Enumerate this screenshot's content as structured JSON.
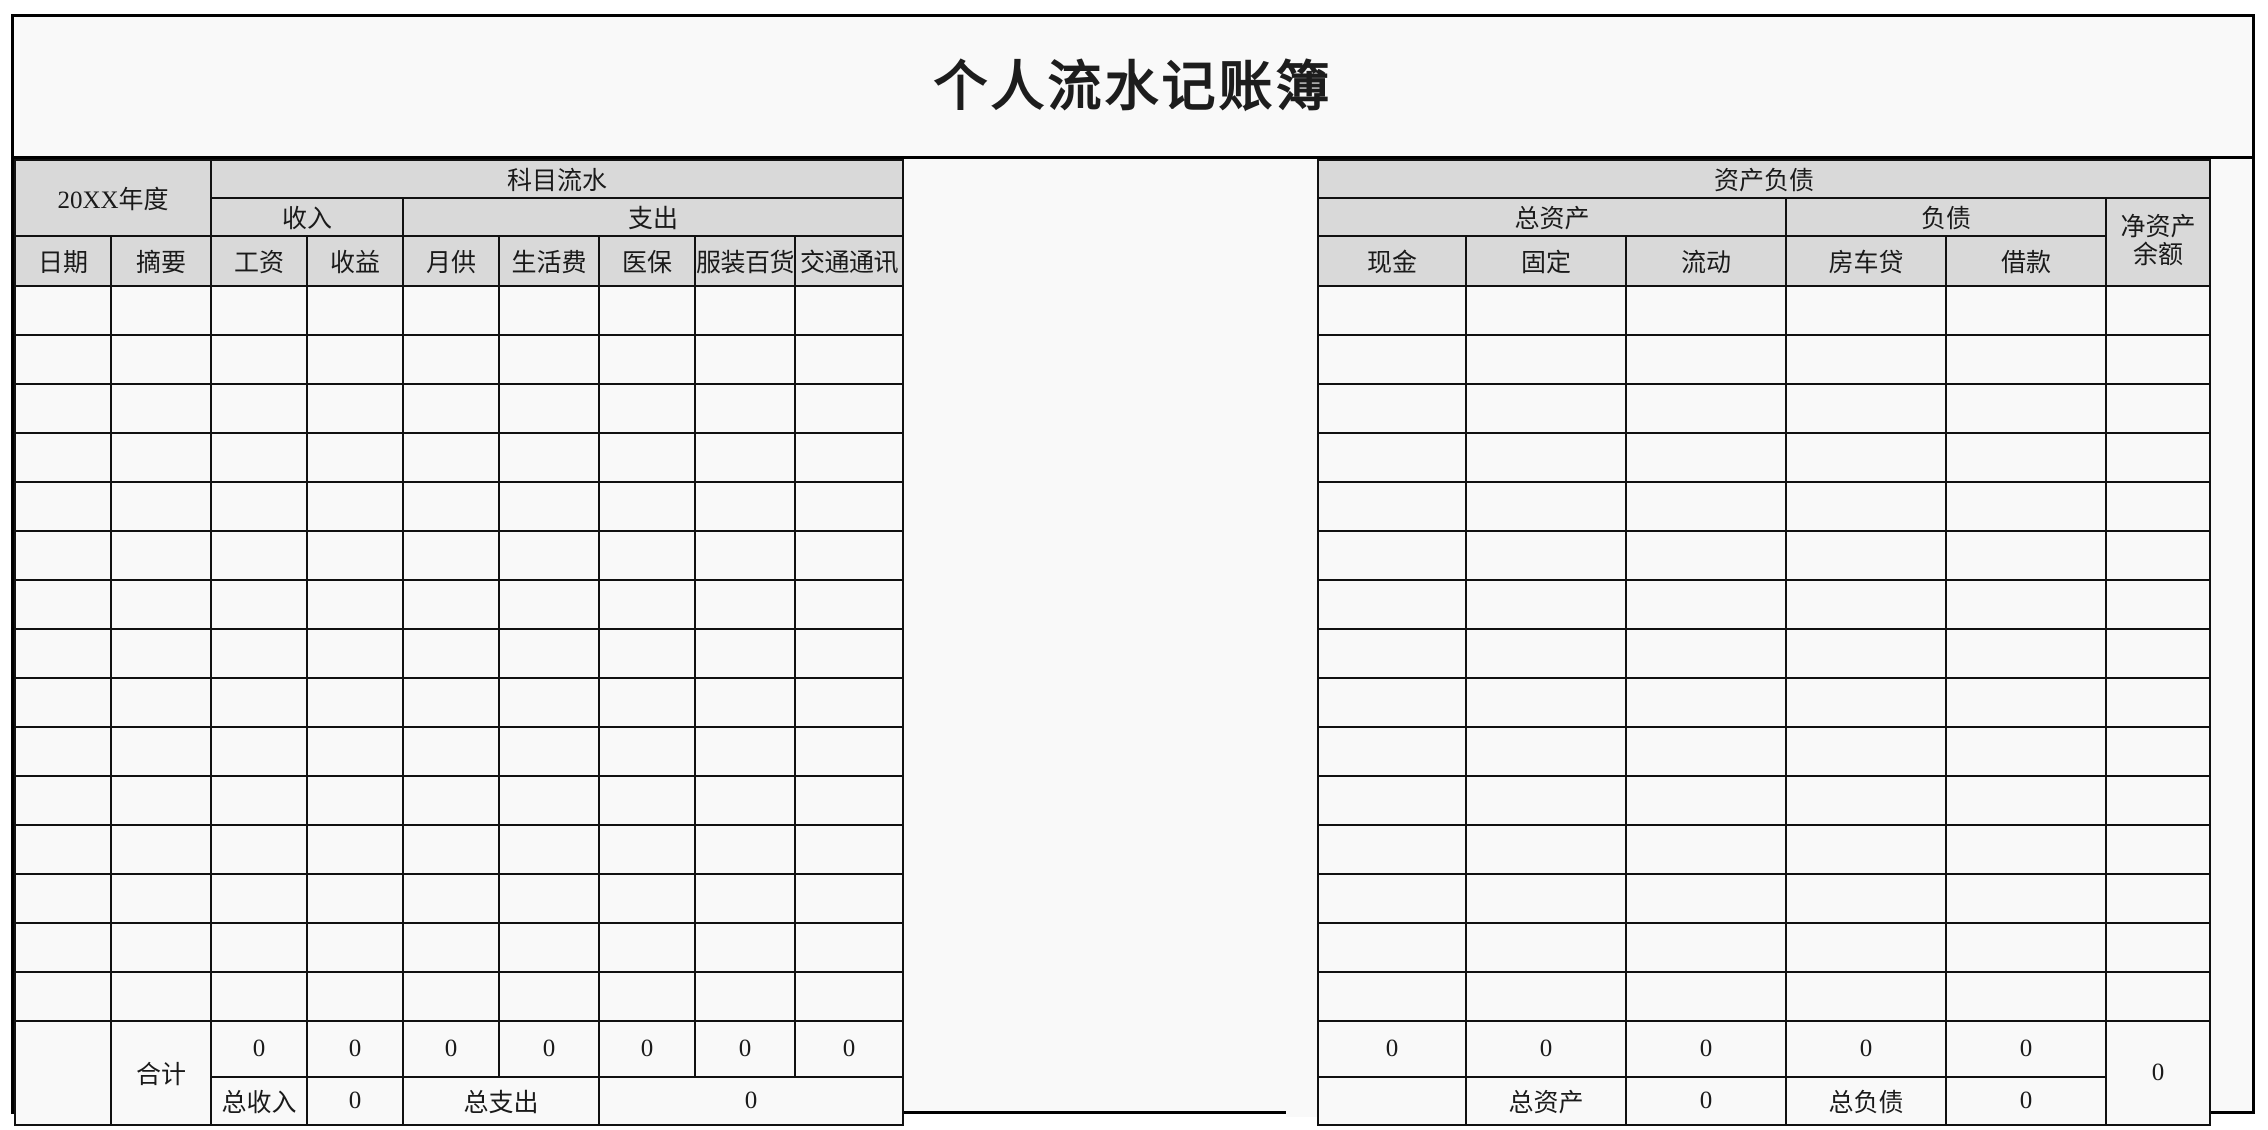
{
  "document": {
    "title": "个人流水记账簿",
    "year_label": "20XX年度"
  },
  "left_section": {
    "group_title": "科目流水",
    "subgroups": [
      {
        "label": "收入",
        "span": 2
      },
      {
        "label": "支出",
        "span": 5
      }
    ],
    "columns": [
      "日期",
      "摘要",
      "工资",
      "收益",
      "月供",
      "生活费",
      "医保",
      "服装百货",
      "交通通讯"
    ],
    "data_rows": 15,
    "total_label": "合计",
    "totals": [
      "0",
      "0",
      "0",
      "0",
      "0",
      "0",
      "0"
    ],
    "summary": {
      "income_label": "总收入",
      "income_value": "0",
      "expense_label": "总支出",
      "expense_value": "0"
    }
  },
  "right_section": {
    "group_title": "资产负债",
    "subgroups": [
      {
        "label": "总资产",
        "span": 3
      },
      {
        "label": "负债",
        "span": 2
      }
    ],
    "net_label": "净资产\n余额",
    "net_label_line1": "净资产",
    "net_label_line2": "余额",
    "columns": [
      "现金",
      "固定",
      "流动",
      "房车贷",
      "借款"
    ],
    "data_rows": 15,
    "totals": [
      "0",
      "0",
      "0",
      "0",
      "0"
    ],
    "net_total": "0",
    "summary": {
      "assets_label": "总资产",
      "assets_value": "0",
      "liabilities_label": "总负债",
      "liabilities_value": "0"
    }
  },
  "colors": {
    "header_fill": "#d9d9d9",
    "cell_fill": "#f9f9f9",
    "border": "#111111",
    "text": "#1a1a1a"
  }
}
